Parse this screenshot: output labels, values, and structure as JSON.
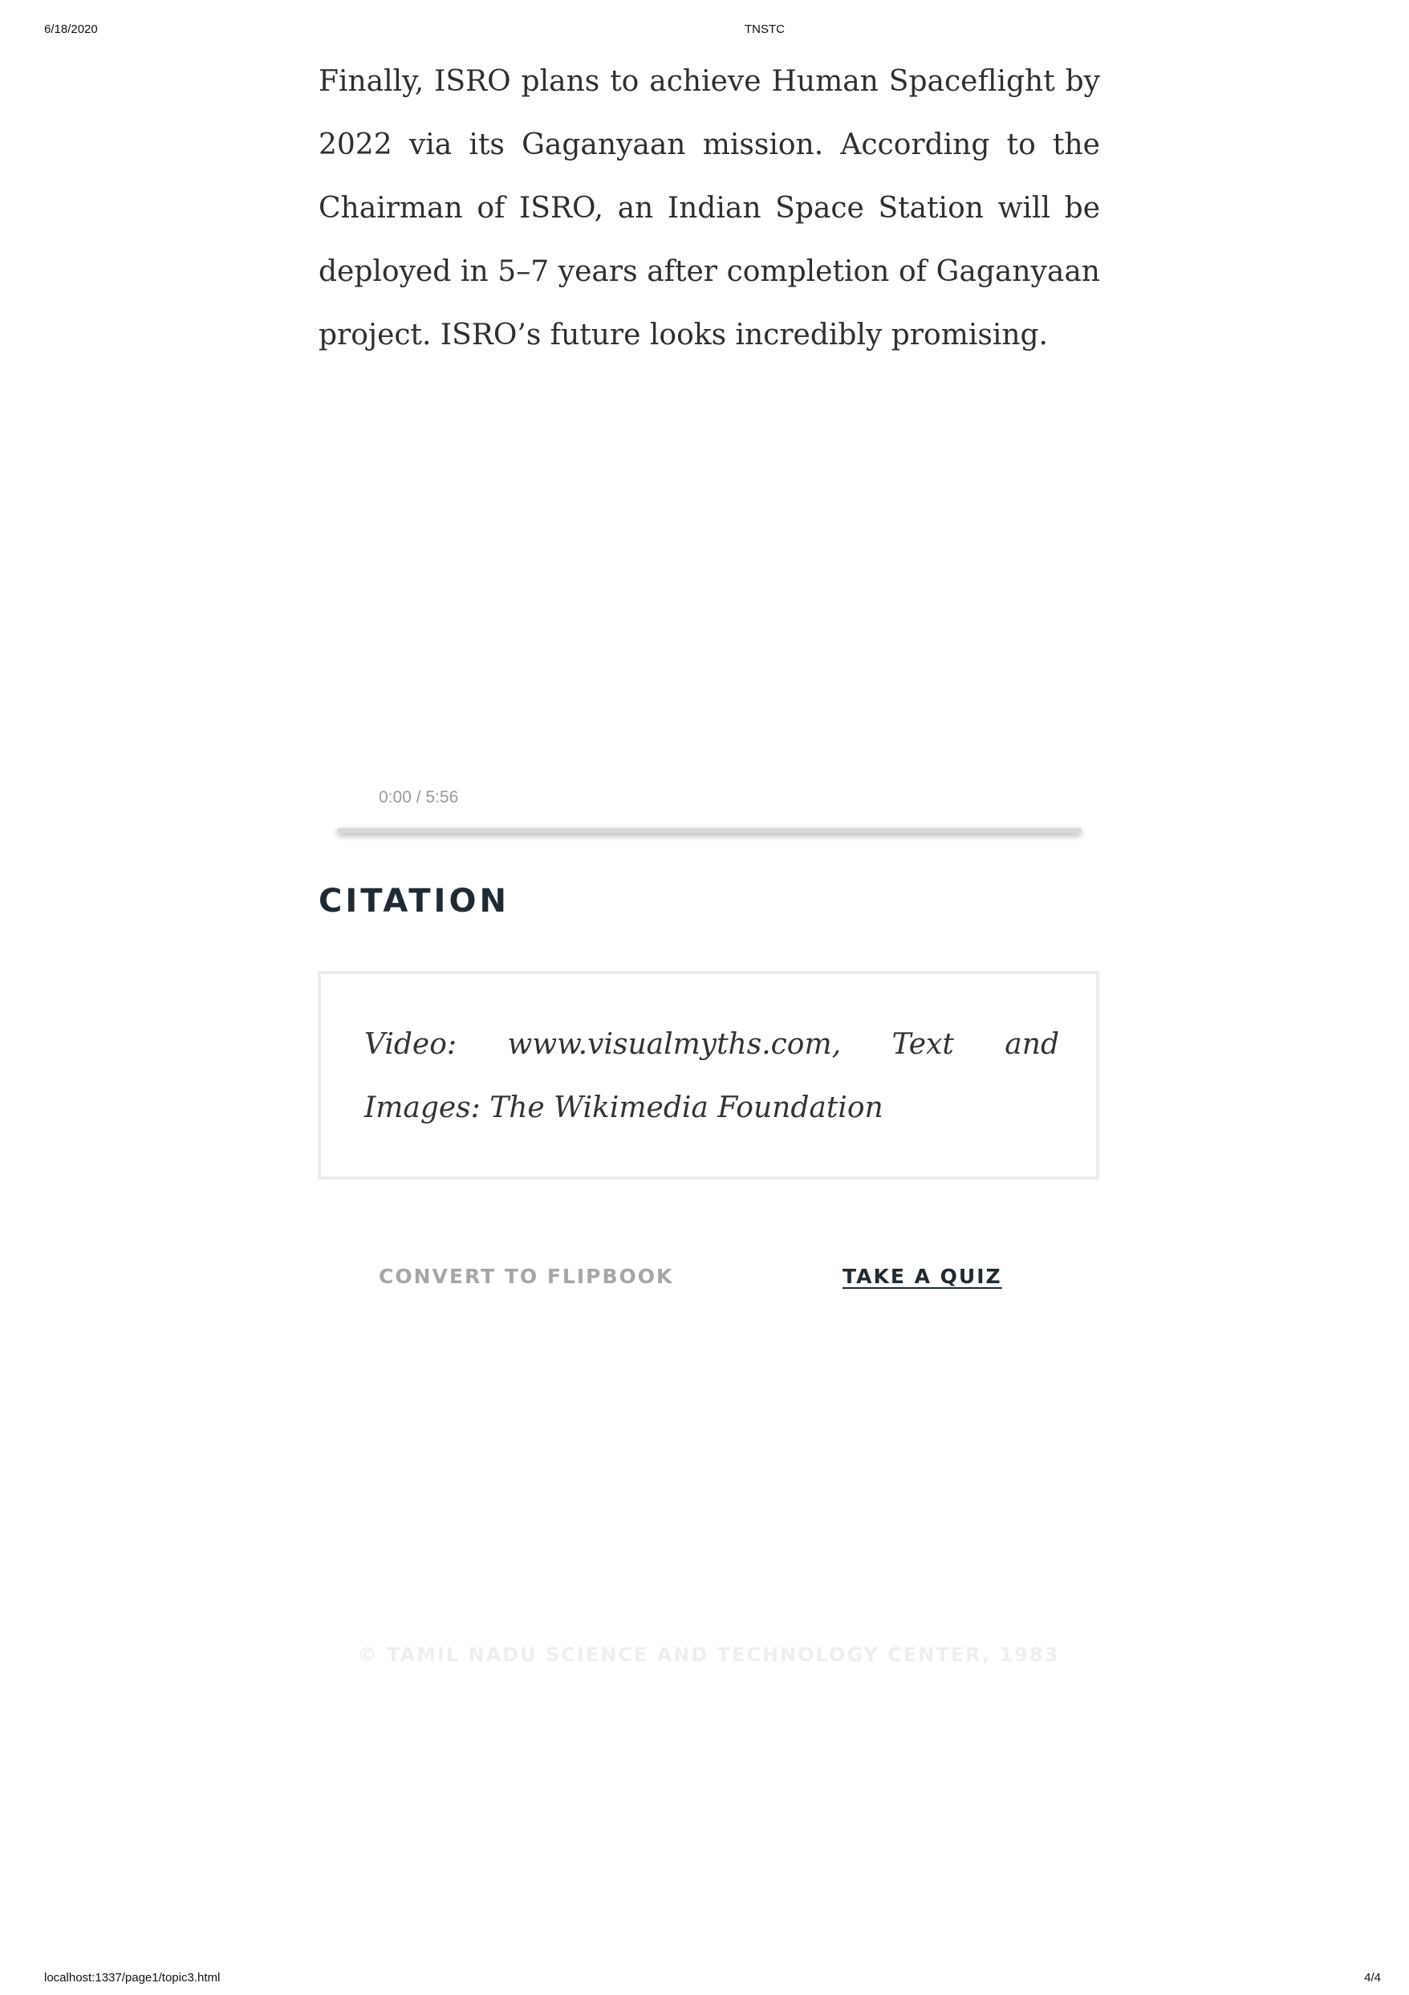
{
  "print_header": {
    "date": "6/18/2020",
    "title": "TNSTC"
  },
  "article": {
    "paragraph": "Finally, ISRO plans to achieve Human Spaceflight by 2022 via its Gaganyaan mission. According to the Chairman of ISRO, an Indian Space Station will be deployed in 5–7 years after completion of Gaganyaan project. ISRO’s future looks incredibly promising."
  },
  "video": {
    "time": "0:00 / 5:56",
    "progress": 0
  },
  "citation": {
    "heading": "CITATION",
    "text": "Video: www.visualmyths.com, Text and Images: The Wikimedia Foundation"
  },
  "actions": {
    "flipbook_label": "CONVERT TO FLIPBOOK",
    "quiz_label": "TAKE A QUIZ"
  },
  "footer": {
    "copyright": "© TAMIL NADU SCIENCE AND TECHNOLOGY CENTER, 1983"
  },
  "print_footer": {
    "url": "localhost:1337/page1/topic3.html",
    "page": "4/4"
  },
  "colors": {
    "heading": "#1f2a33",
    "muted_button": "#a6a6a6",
    "copyright": "#eeeeee"
  }
}
